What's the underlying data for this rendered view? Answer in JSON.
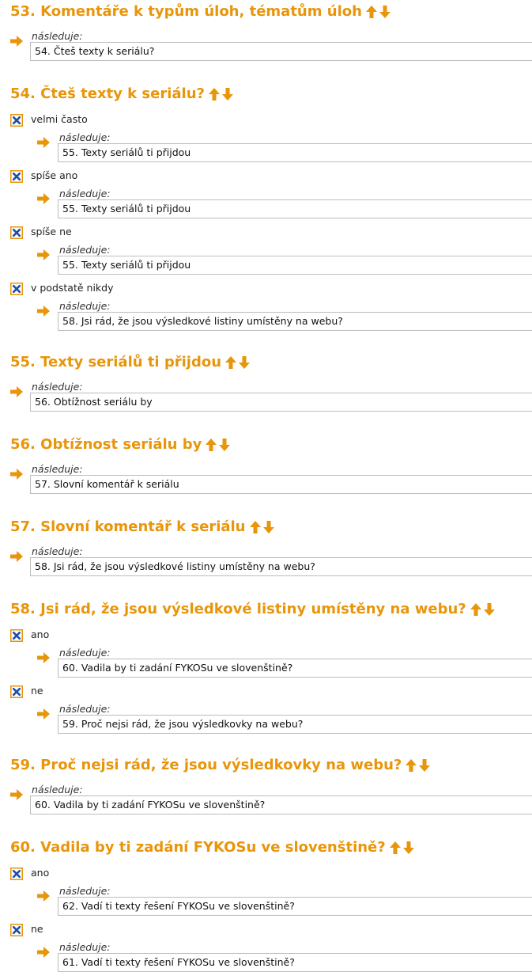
{
  "colors": {
    "accent": "#e8950a",
    "check_fill": "#1f4fa8",
    "border": "#bdbdbd"
  },
  "icons": {
    "sort_up": "arrow-up-icon",
    "sort_down": "arrow-down-icon",
    "next": "arrow-right-icon",
    "option": "checkbox-x-icon"
  },
  "follows_text": "následuje:",
  "questions": [
    {
      "title": "53. Komentáře k typům úloh, tématům úloh",
      "next": "54. Čteš texty k seriálu?",
      "options": []
    },
    {
      "title": "54. Čteš texty k seriálu?",
      "options": [
        {
          "label": "velmi často",
          "next": "55. Texty seriálů ti přijdou"
        },
        {
          "label": "spíše ano",
          "next": "55. Texty seriálů ti přijdou"
        },
        {
          "label": "spíše ne",
          "next": "55. Texty seriálů ti přijdou"
        },
        {
          "label": "v podstatě nikdy",
          "next": "58. Jsi rád, že jsou výsledkové listiny umístěny na webu?"
        }
      ]
    },
    {
      "title": "55. Texty seriálů ti přijdou",
      "next": "56. Obtížnost seriálu by",
      "options": []
    },
    {
      "title": "56. Obtížnost seriálu by",
      "next": "57. Slovní komentář k seriálu",
      "options": []
    },
    {
      "title": "57. Slovní komentář k seriálu",
      "next": "58. Jsi rád, že jsou výsledkové listiny umístěny na webu?",
      "options": []
    },
    {
      "title": "58. Jsi rád, že jsou výsledkové listiny umístěny na webu?",
      "options": [
        {
          "label": "ano",
          "next": "60. Vadila by ti zadání FYKOSu ve slovenštině?"
        },
        {
          "label": "ne",
          "next": "59. Proč nejsi rád, že jsou výsledkovky na webu?"
        }
      ]
    },
    {
      "title": "59. Proč nejsi rád, že jsou výsledkovky na webu?",
      "next": "60. Vadila by ti zadání FYKOSu ve slovenštině?",
      "options": []
    },
    {
      "title": "60. Vadila by ti zadání FYKOSu ve slovenštině?",
      "options": [
        {
          "label": "ano",
          "next": "62. Vadí ti texty řešení FYKOSu ve slovenštině?"
        },
        {
          "label": "ne",
          "next": "61. Vadí ti texty řešení FYKOSu ve slovenštině?"
        }
      ]
    }
  ]
}
